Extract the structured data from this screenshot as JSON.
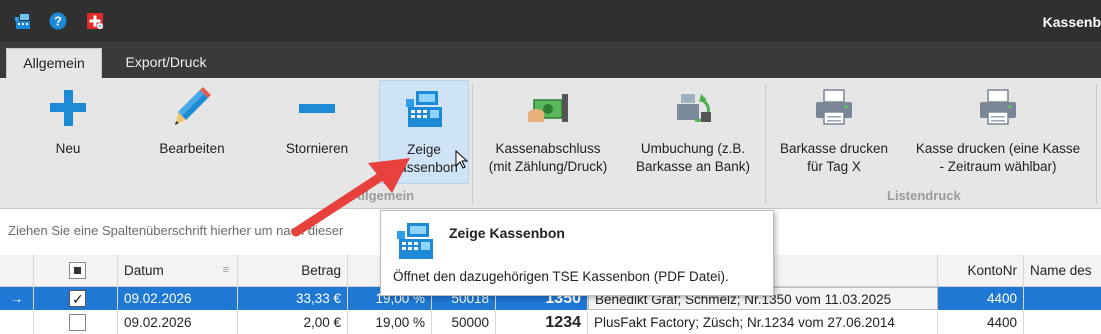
{
  "window": {
    "title": "Kassenb"
  },
  "quick_access": [
    {
      "icon": "cashregister-icon"
    },
    {
      "icon": "help-icon"
    },
    {
      "icon": "swiss-flag-icon"
    }
  ],
  "tabs": [
    {
      "label": "Allgemein",
      "active": true
    },
    {
      "label": "Export/Druck",
      "active": false
    }
  ],
  "ribbon": {
    "buttons": [
      {
        "label": "Neu",
        "icon": "plus-icon"
      },
      {
        "label": "Bearbeiten",
        "icon": "pencil-icon"
      },
      {
        "label": "Stornieren",
        "icon": "minus-icon"
      },
      {
        "label": "Zeige Kassenbon",
        "line1": "Zeige",
        "line2": "Kassenbon",
        "icon": "cash-register-icon",
        "state": "hover"
      },
      {
        "label": "Kassenabschluss (mit Zählung/Druck)",
        "line1": "Kassenabschluss",
        "line2": "(mit Zählung/Druck)",
        "icon": "money-hand-icon"
      },
      {
        "label": "Umbuchung (z.B. Barkasse an Bank)",
        "line1": "Umbuchung (z.B.",
        "line2": "Barkasse an Bank)",
        "icon": "register-transfer-icon"
      },
      {
        "label": "Barkasse drucken für Tag X",
        "line1": "Barkasse drucken",
        "line2": "für Tag X",
        "icon": "printer-icon"
      },
      {
        "label": "Kasse drucken (eine Kasse - Zeitraum wählbar)",
        "line1": "Kasse drucken (eine Kasse",
        "line2": "- Zeitraum wählbar)",
        "icon": "printer-icon"
      }
    ],
    "groups": [
      "Allgemein",
      "Listendruck"
    ]
  },
  "group_panel": {
    "hint": "Ziehen Sie eine Spaltenüberschrift hierher um nach dieser"
  },
  "table": {
    "columns": [
      "Datum",
      "Betrag",
      "KontoNr",
      "Name des"
    ],
    "rows": [
      {
        "selected": true,
        "checked": true,
        "datum": "09.02.2026",
        "betrag": "33,33 €",
        "mwst": "19,00 %",
        "konto": "50018",
        "nr": "1350",
        "text": "Benedikt Graf; Schmelz; Nr.1350 vom 11.03.2025",
        "kontonr": "4400"
      },
      {
        "selected": false,
        "checked": false,
        "datum": "09.02.2026",
        "betrag": "2,00 €",
        "mwst": "19,00 %",
        "konto": "50000",
        "nr": "1234",
        "text": "PlusFakt Factory; Züsch; Nr.1234 vom 27.06.2014",
        "kontonr": "4400"
      }
    ]
  },
  "tooltip": {
    "title": "Zeige Kassenbon",
    "text": "Öffnet  den dazugehörigen TSE Kassenbon (PDF Datei).",
    "icon": "cash-register-icon"
  },
  "colors": {
    "accent": "#1E78D4",
    "ribbon_bg": "#E6E6E6",
    "titlebar": "#303030",
    "arrow": "#E8403C"
  }
}
